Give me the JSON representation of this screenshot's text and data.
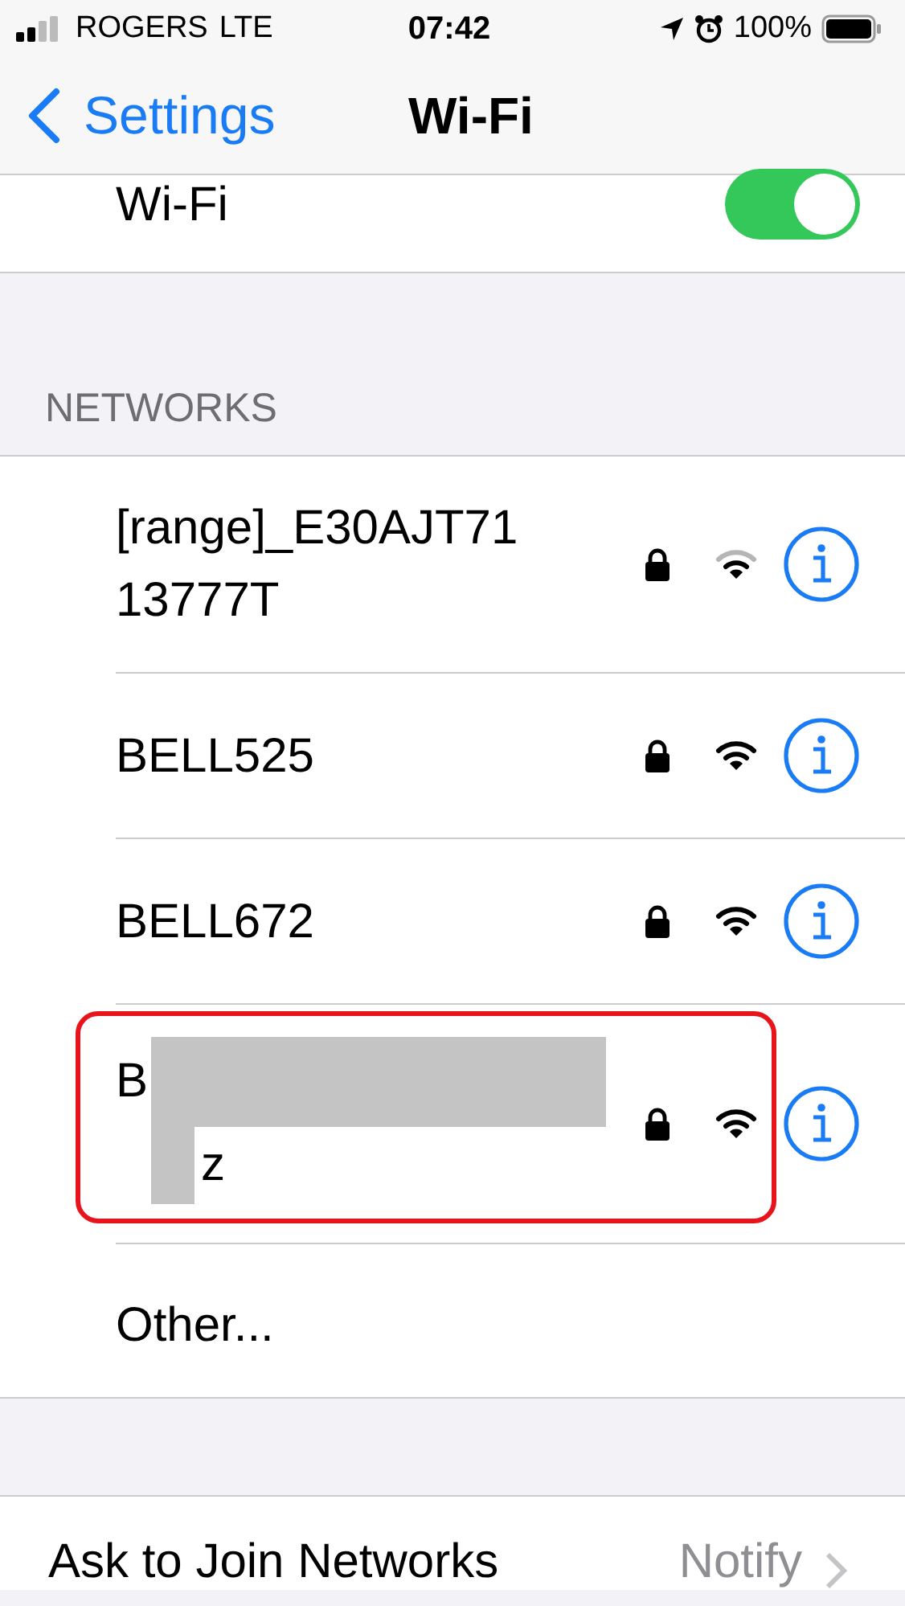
{
  "status_bar": {
    "carrier": "ROGERS",
    "network": "LTE",
    "time": "07:42",
    "battery": "100%"
  },
  "nav": {
    "back": "Settings",
    "title": "Wi-Fi"
  },
  "wifi_toggle": {
    "label": "Wi-Fi",
    "on": true
  },
  "networks_header": "NETWORKS",
  "networks": [
    {
      "kind": "network",
      "name": "[range]_E30AJT7113777T",
      "locked": true,
      "weak_signal": true,
      "highlighted": false
    },
    {
      "kind": "network",
      "name": "BELL525",
      "locked": true,
      "weak_signal": false,
      "highlighted": false
    },
    {
      "kind": "network",
      "name": "BELL672",
      "locked": true,
      "weak_signal": false,
      "highlighted": false
    },
    {
      "kind": "redacted",
      "name": "B",
      "name_line2": "z",
      "locked": true,
      "weak_signal": false,
      "highlighted": true
    },
    {
      "kind": "other",
      "name": "Other..."
    }
  ],
  "ask_to_join": {
    "label": "Ask to Join Networks",
    "value": "Notify"
  }
}
